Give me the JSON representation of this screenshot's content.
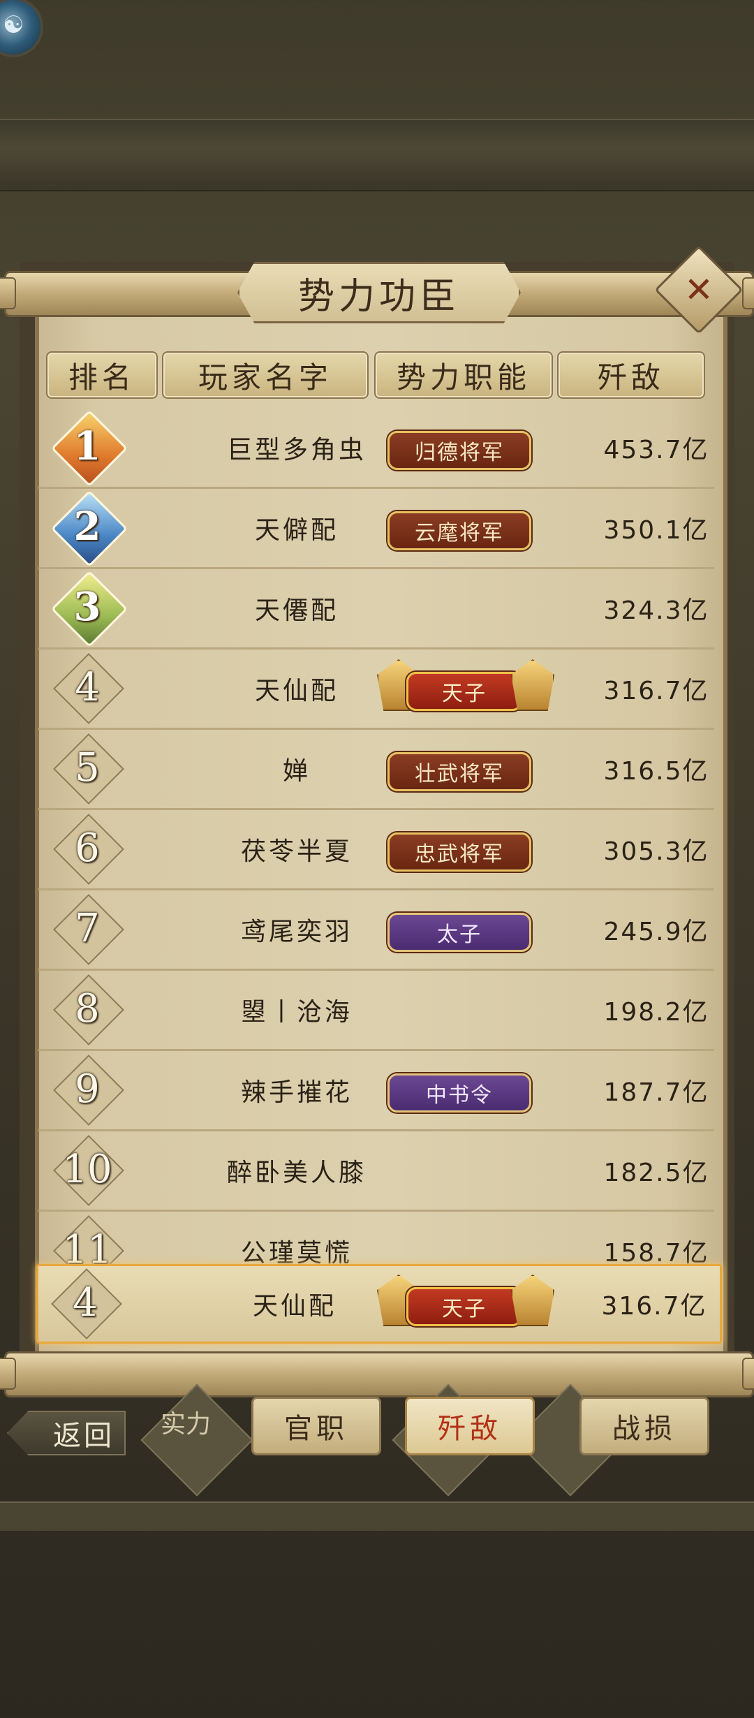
{
  "title": "势力功臣",
  "close_label": "✕",
  "headers": [
    "排名",
    "玩家名字",
    "势力职能",
    "歼敌"
  ],
  "rows": [
    {
      "rank": "1",
      "name": "巨型多角虫",
      "title": "归德将军",
      "badge_style": "brown",
      "value": "453.7亿"
    },
    {
      "rank": "2",
      "name": "天僻配",
      "title": "云麾将军",
      "badge_style": "brown",
      "value": "350.1亿"
    },
    {
      "rank": "3",
      "name": "天僊配",
      "title": "",
      "badge_style": "",
      "value": "324.3亿"
    },
    {
      "rank": "4",
      "name": "天仙配",
      "title": "天子",
      "badge_style": "red",
      "value": "316.7亿"
    },
    {
      "rank": "5",
      "name": "婵",
      "title": "壮武将军",
      "badge_style": "brown",
      "value": "316.5亿"
    },
    {
      "rank": "6",
      "name": "茯苓半夏",
      "title": "忠武将军",
      "badge_style": "brown",
      "value": "305.3亿"
    },
    {
      "rank": "7",
      "name": "鸢尾奕羽",
      "title": "太子",
      "badge_style": "purple",
      "value": "245.9亿"
    },
    {
      "rank": "8",
      "name": "曌丨沧海",
      "title": "",
      "badge_style": "",
      "value": "198.2亿"
    },
    {
      "rank": "9",
      "name": "辣手摧花",
      "title": "中书令",
      "badge_style": "purple",
      "value": "187.7亿"
    },
    {
      "rank": "10",
      "name": "醉卧美人膝",
      "title": "",
      "badge_style": "",
      "value": "182.5亿"
    },
    {
      "rank": "11",
      "name": "公瑾莫慌",
      "title": "",
      "badge_style": "",
      "value": "158.7亿"
    }
  ],
  "my_row": {
    "rank": "4",
    "name": "天仙配",
    "title": "天子",
    "value": "316.7亿"
  },
  "tabs": {
    "official": "官职",
    "kill": "歼敌",
    "loss": "战损"
  },
  "back_label": "返回",
  "bg_labels": {
    "strength": "实力"
  },
  "top_icon": "dragon-emblem-icon"
}
